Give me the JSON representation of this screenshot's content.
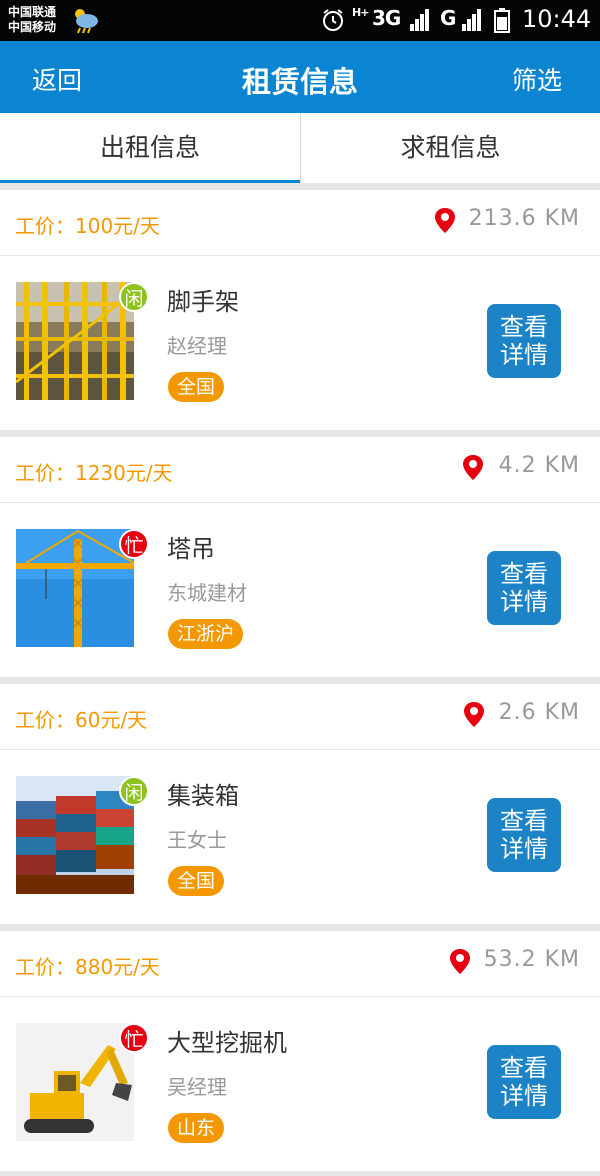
{
  "status_bar": {
    "carrier_1": "中国联通",
    "carrier_2": "中国移动",
    "network_1": "3G",
    "network_2": "G",
    "time": "10:44",
    "icons": [
      "weather-icon",
      "alarm-icon",
      "signal-icon",
      "battery-icon"
    ]
  },
  "nav": {
    "back_label": "返回",
    "title": "租赁信息",
    "filter_label": "筛选",
    "color": "#0b85d2"
  },
  "tabs": [
    {
      "label": "出租信息",
      "selected": true
    },
    {
      "label": "求租信息",
      "selected": false
    }
  ],
  "listings": [
    {
      "price": "工价：100元/天",
      "distance": "213.6  KM",
      "name": "脚手架",
      "owner": "赵经理",
      "region": "全国",
      "status": "闲",
      "status_color": "#8dc21f",
      "detail_label_1": "查看",
      "detail_label_2": "详情",
      "image": "scaffold"
    },
    {
      "price": "工价：1230元/天",
      "distance": "4.2  KM",
      "name": "塔吊",
      "owner": "东城建材",
      "region": "江浙沪",
      "status": "忙",
      "status_color": "#e60012",
      "detail_label_1": "查看",
      "detail_label_2": "详情",
      "image": "tower-crane"
    },
    {
      "price": "工价：60元/天",
      "distance": "2.6  KM",
      "name": "集装箱",
      "owner": "王女士",
      "region": "全国",
      "status": "闲",
      "status_color": "#8dc21f",
      "detail_label_1": "查看",
      "detail_label_2": "详情",
      "image": "containers"
    },
    {
      "price": "工价：880元/天",
      "distance": "53.2  KM",
      "name": "大型挖掘机",
      "owner": "吴经理",
      "region": "山东",
      "status": "忙",
      "status_color": "#e60012",
      "detail_label_1": "查看",
      "detail_label_2": "详情",
      "image": "excavator"
    }
  ],
  "colors": {
    "accent": "#0b85d2",
    "price": "#f39800",
    "button": "#1b83c6",
    "pin": "#e60012"
  }
}
